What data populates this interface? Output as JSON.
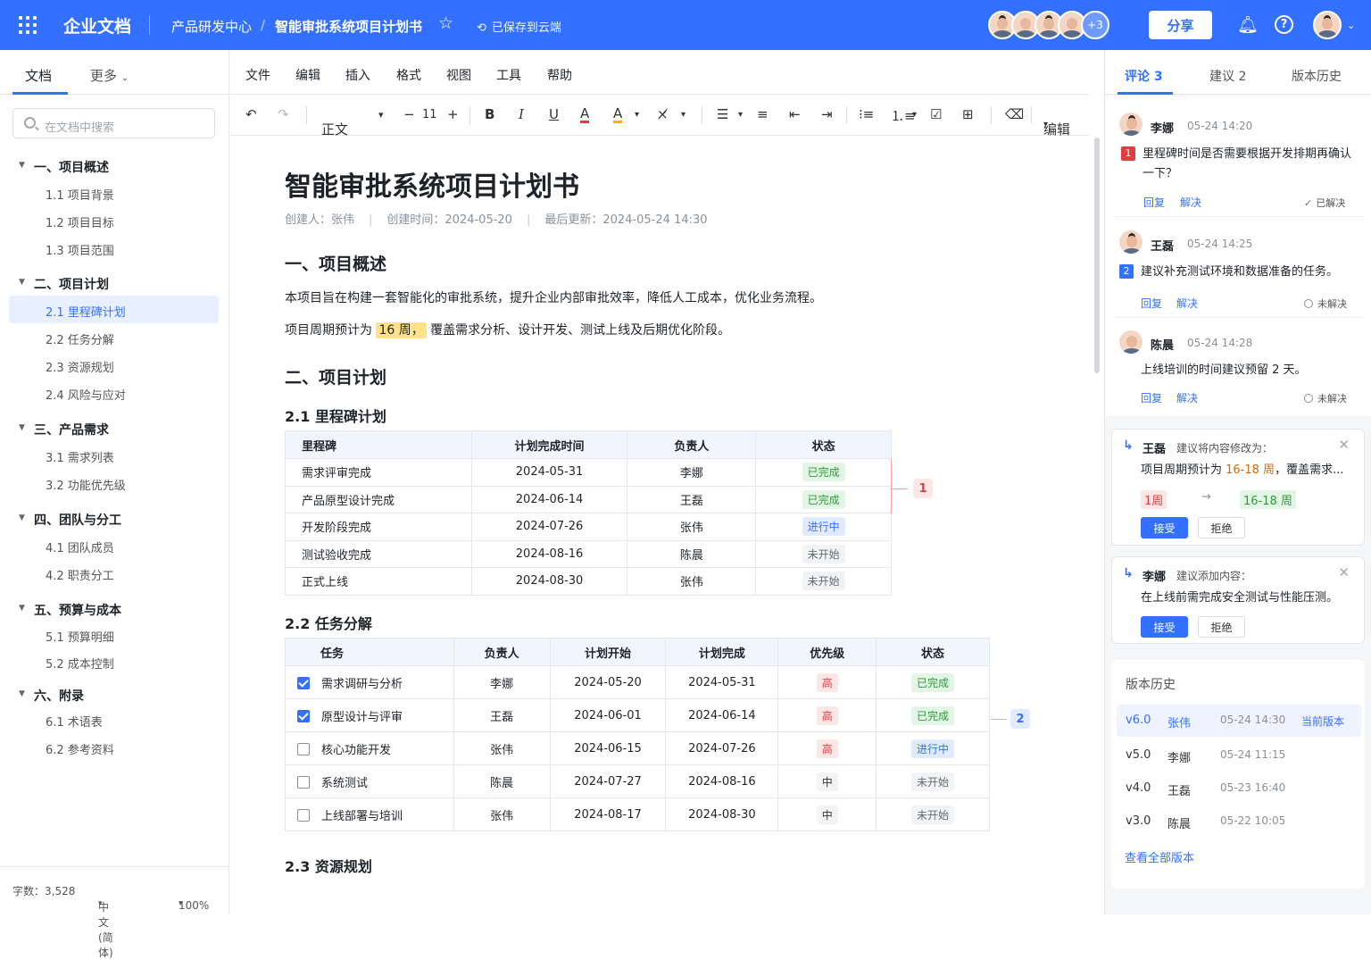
{
  "header": {
    "brand": "企业文档",
    "breadcrumb_parent": "产品研发中心",
    "breadcrumb_sep": "/",
    "doc_name": "智能审批系统项目计划书",
    "saved_status": "已保存到云端",
    "more_collaborators": "+3",
    "share_label": "分享"
  },
  "sidebar": {
    "tab_doc": "文档",
    "tab_more": "更多",
    "search_placeholder": "在文档中搜索",
    "sections": [
      {
        "label": "一、项目概述",
        "items": [
          "1.1  项目背景",
          "1.2  项目目标",
          "1.3  项目范围"
        ]
      },
      {
        "label": "二、项目计划",
        "items": [
          "2.1  里程碑计划",
          "2.2  任务分解",
          "2.3  资源规划",
          "2.4  风险与应对"
        ]
      },
      {
        "label": "三、产品需求",
        "items": [
          "3.1  需求列表",
          "3.2  功能优先级"
        ]
      },
      {
        "label": "四、团队与分工",
        "items": [
          "4.1  团队成员",
          "4.2  职责分工"
        ]
      },
      {
        "label": "五、预算与成本",
        "items": [
          "5.1  预算明细",
          "5.2  成本控制"
        ]
      },
      {
        "label": "六、附录",
        "items": [
          "6.1  术语表",
          "6.2  参考资料"
        ]
      }
    ],
    "footer": {
      "word_count": "字数：3,528",
      "language": "中文(简体)",
      "zoom": "100%"
    }
  },
  "menu": [
    "文件",
    "编辑",
    "插入",
    "格式",
    "视图",
    "工具",
    "帮助"
  ],
  "toolbar": {
    "style": "正文",
    "font_size": "11",
    "mode": "编辑"
  },
  "doc": {
    "title": "智能审批系统项目计划书",
    "creator": "创建人：张伟",
    "created": "创建时间：2024-05-20",
    "updated": "最后更新：2024-05-24 14:30",
    "h1_overview": "一、项目概述",
    "p1": "本项目旨在构建一套智能化的审批系统，提升企业内部审批效率，降低人工成本，优化业务流程。",
    "p2_before": "项目周期预计为 ",
    "p2_highlight": "16 周，",
    "p2_after": " 覆盖需求分析、设计开发、测试上线及后期优化阶段。",
    "h1_plan": "二、项目计划",
    "h2_milestone": "2.1 里程碑计划",
    "h2_tasks": "2.2 任务分解",
    "h2_resources": "2.3 资源规划",
    "milestone_headers": [
      "里程碑",
      "计划完成时间",
      "负责人",
      "状态"
    ],
    "milestones": [
      {
        "name": "需求评审完成",
        "date": "2024-05-31",
        "owner": "李娜",
        "status": "已完成",
        "kind": "done"
      },
      {
        "name": "产品原型设计完成",
        "date": "2024-06-14",
        "owner": "王磊",
        "status": "已完成",
        "kind": "done"
      },
      {
        "name": "开发阶段完成",
        "date": "2024-07-26",
        "owner": "张伟",
        "status": "进行中",
        "kind": "prog"
      },
      {
        "name": "测试验收完成",
        "date": "2024-08-16",
        "owner": "陈晨",
        "status": "未开始",
        "kind": "todo"
      },
      {
        "name": "正式上线",
        "date": "2024-08-30",
        "owner": "张伟",
        "status": "未开始",
        "kind": "todo"
      }
    ],
    "task_headers": [
      "任务",
      "负责人",
      "计划开始",
      "计划完成",
      "优先级",
      "状态"
    ],
    "tasks": [
      {
        "checked": true,
        "name": "需求调研与分析",
        "owner": "李娜",
        "start": "2024-05-20",
        "end": "2024-05-31",
        "priority": "高",
        "pkind": "hi",
        "status": "已完成",
        "kind": "done"
      },
      {
        "checked": true,
        "name": "原型设计与评审",
        "owner": "王磊",
        "start": "2024-06-01",
        "end": "2024-06-14",
        "priority": "高",
        "pkind": "hi",
        "status": "已完成",
        "kind": "done"
      },
      {
        "checked": false,
        "name": "核心功能开发",
        "owner": "张伟",
        "start": "2024-06-15",
        "end": "2024-07-26",
        "priority": "高",
        "pkind": "hi",
        "status": "进行中",
        "kind": "prog"
      },
      {
        "checked": false,
        "name": "系统测试",
        "owner": "陈晨",
        "start": "2024-07-27",
        "end": "2024-08-16",
        "priority": "中",
        "pkind": "mid",
        "status": "未开始",
        "kind": "todo"
      },
      {
        "checked": false,
        "name": "上线部署与培训",
        "owner": "张伟",
        "start": "2024-08-17",
        "end": "2024-08-30",
        "priority": "中",
        "pkind": "mid",
        "status": "未开始",
        "kind": "todo"
      }
    ],
    "anchor1": "1",
    "anchor2": "2"
  },
  "panel": {
    "tab_comments": "评论 3",
    "tab_suggestions": "建议 2",
    "tab_history": "版本历史",
    "reply": "回复",
    "resolve": "解决",
    "comments": [
      {
        "user": "李娜",
        "time": "05-24 14:20",
        "num": "1",
        "text1": "里程碑时间是否需要根据开发排期再确认",
        "text2": "一下？",
        "status": "已解决"
      },
      {
        "user": "王磊",
        "time": "05-24 14:25",
        "num": "2",
        "text1": "建议补充测试环境和数据准备的任务。",
        "status": "未解决"
      },
      {
        "user": "陈晨",
        "time": "05-24 14:28",
        "text1": "上线培训的时间建议预留 2 天。",
        "status": "未解决"
      }
    ],
    "suggestions": [
      {
        "user": "王磊",
        "action": "建议将内容修改为：",
        "text_before": "项目周期预计为 ",
        "text_hl": "16-18 周",
        "text_after": "，覆盖需求...",
        "old": "1周",
        "arrow": "→",
        "new": "16-18 周",
        "accept": "接受",
        "reject": "拒绝"
      },
      {
        "user": "李娜",
        "action": "建议添加内容：",
        "text": "在上线前需完成安全测试与性能压测。",
        "accept": "接受",
        "reject": "拒绝"
      }
    ],
    "history_title": "版本历史",
    "versions": [
      {
        "ver": "v6.0",
        "user": "张伟",
        "time": "05-24 14:30",
        "tag": "当前版本"
      },
      {
        "ver": "v5.0",
        "user": "李娜",
        "time": "05-24 11:15"
      },
      {
        "ver": "v4.0",
        "user": "王磊",
        "time": "05-23 16:40"
      },
      {
        "ver": "v3.0",
        "user": "陈晨",
        "time": "05-22 10:05"
      }
    ],
    "view_all": "查看全部版本"
  },
  "colors": {
    "accent": "#3370ff",
    "done": "#2e9b3a",
    "danger": "#e03e3e",
    "highlight": "#ffe28a"
  }
}
